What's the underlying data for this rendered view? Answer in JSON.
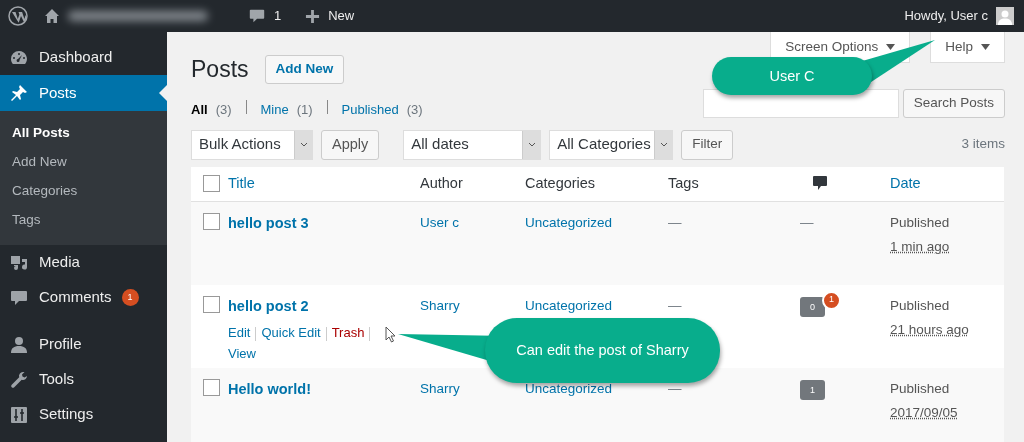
{
  "admin_bar": {
    "comments_count": "1",
    "new_label": "New",
    "greeting": "Howdy, User c"
  },
  "sidebar": {
    "items": [
      {
        "label": "Dashboard",
        "selected": false
      },
      {
        "label": "Posts",
        "selected": true,
        "children": [
          {
            "label": "All Posts",
            "selected": true
          },
          {
            "label": "Add New",
            "selected": false
          },
          {
            "label": "Categories",
            "selected": false
          },
          {
            "label": "Tags",
            "selected": false
          }
        ]
      },
      {
        "label": "Media",
        "selected": false
      },
      {
        "label": "Comments",
        "selected": false,
        "badge": "1"
      },
      {
        "label": "Profile",
        "selected": false
      },
      {
        "label": "Tools",
        "selected": false
      },
      {
        "label": "Settings",
        "selected": false
      }
    ]
  },
  "screen_meta": {
    "tabs": [
      "Screen Options",
      "Help"
    ]
  },
  "page": {
    "title": "Posts",
    "add_new": "Add New"
  },
  "views": [
    {
      "label": "All",
      "count": "(3)",
      "selected": true
    },
    {
      "label": "Mine",
      "count": "(1)",
      "selected": false
    },
    {
      "label": "Published",
      "count": "(3)",
      "selected": false
    }
  ],
  "search": {
    "button": "Search Posts"
  },
  "filters": {
    "bulk_actions": "Bulk Actions",
    "apply": "Apply",
    "dates": "All dates",
    "categories": "All Categories",
    "filter": "Filter"
  },
  "items_count": "3 items",
  "table": {
    "select_all_checked": false,
    "columns": [
      {
        "kind": "text",
        "label": "Title",
        "sortable": true
      },
      {
        "kind": "text",
        "label": "Author",
        "sortable": false
      },
      {
        "kind": "text",
        "label": "Categories",
        "sortable": false
      },
      {
        "kind": "text",
        "label": "Tags",
        "sortable": false
      },
      {
        "kind": "comments"
      },
      {
        "kind": "text",
        "label": "Date",
        "sortable": true
      }
    ],
    "rows": [
      {
        "checked": false,
        "title": "hello post 3",
        "author": "User c",
        "category": "Uncategorized",
        "tags": "—",
        "comments": {
          "kind": "none",
          "text": "—"
        },
        "status": "Published",
        "date": "1 min ago",
        "actions": []
      },
      {
        "checked": false,
        "title": "hello post 2",
        "author": "Sharry",
        "category": "Uncategorized",
        "tags": "—",
        "comments": {
          "kind": "bubble",
          "count": "0",
          "pending": "1"
        },
        "status": "Published",
        "date": "21 hours ago",
        "actions": [
          {
            "label": "Edit",
            "kind": "link"
          },
          {
            "label": "Quick Edit",
            "kind": "link"
          },
          {
            "label": "Trash",
            "kind": "danger"
          },
          {
            "label": "View",
            "kind": "link"
          }
        ]
      },
      {
        "checked": false,
        "title": "Hello world!",
        "author": "Sharry",
        "category": "Uncategorized",
        "tags": "—",
        "comments": {
          "kind": "bubble",
          "count": "1"
        },
        "status": "Published",
        "date": "2017/09/05",
        "actions": []
      }
    ]
  },
  "callouts": [
    {
      "text": "User C"
    },
    {
      "text": "Can edit the post of Sharry"
    }
  ]
}
